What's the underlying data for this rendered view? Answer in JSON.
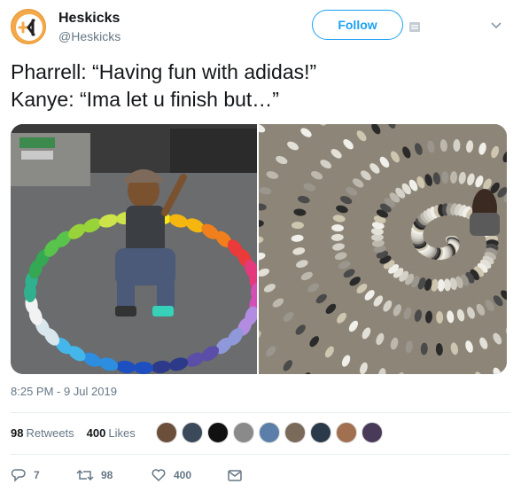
{
  "user": {
    "display_name": "Heskicks",
    "handle": "@Heskicks"
  },
  "follow_label": "Follow",
  "tweet": {
    "line1": "Pharrell: “Having fun with adidas!”",
    "line2": "Kanye: “Ima let u finish but…”"
  },
  "timestamp": "8:25 PM - 9 Jul 2019",
  "stats": {
    "retweets_count": "98",
    "retweets_label": "Retweets",
    "likes_count": "400",
    "likes_label": "Likes"
  },
  "actions": {
    "reply_count": "7",
    "retweet_count": "98",
    "like_count": "400"
  },
  "colors": {
    "accent": "#1da1f2",
    "muted": "#657786",
    "avatar_orange": "#f3a94a"
  },
  "icons": [
    "brand-logo-icon",
    "profile-card-icon",
    "chevron-down-icon",
    "reply-icon",
    "retweet-icon",
    "like-icon",
    "message-icon"
  ]
}
